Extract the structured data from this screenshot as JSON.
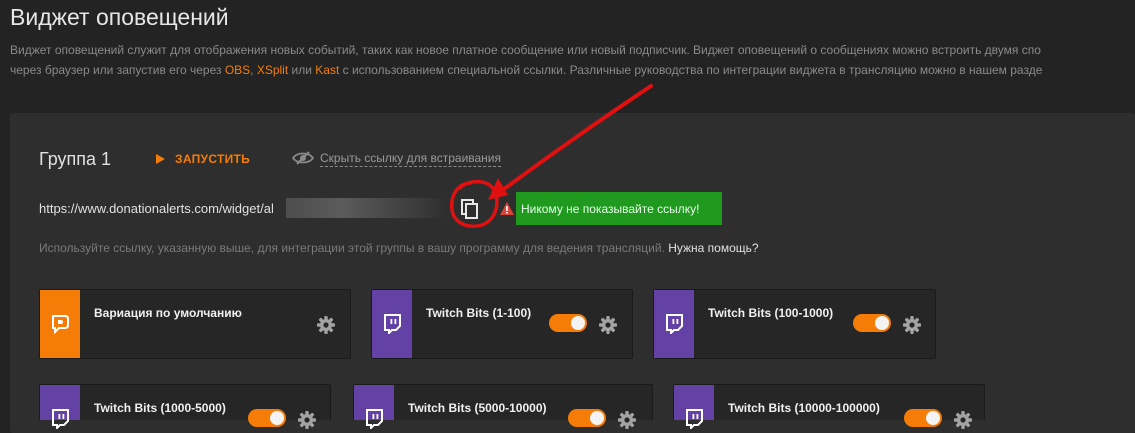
{
  "page": {
    "title": "Виджет оповещений",
    "desc_line1": "Виджет оповещений служит для отображения новых событий, таких как новое платное сообщение или новый подписчик. Виджет оповещений о сообщениях можно встроить двумя спо",
    "desc_line2_pre": "через браузер или запустив его через ",
    "link_obs": "OBS",
    "sep_comma": ", ",
    "link_xsplit": "XSplit",
    "sep_or": " или ",
    "link_kast": "Kast",
    "desc_line2_post": " с использованием специальной ссылки. Различные руководства по интеграции виджета в трансляцию можно в нашем разде"
  },
  "group": {
    "title": "Группа 1",
    "launch_label": "ЗАПУСТИТЬ",
    "hide_link_label": "Скрыть ссылку для встраивания",
    "url_visible": "https://www.donationalerts.com/widget/al",
    "warning": "Никому не показывайте ссылку!",
    "hint": "Используйте ссылку, указанную выше, для интеграции этой группы в вашу программу для ведения трансляций.",
    "help_link": "Нужна помощь?"
  },
  "cards": [
    {
      "name": "Вариация по умолчанию",
      "icon": "donationalerts-icon",
      "accent": "#f57d07",
      "toggle": false
    },
    {
      "name": "Twitch Bits (1-100)",
      "icon": "twitch-icon",
      "accent": "#6441a5",
      "toggle": true
    },
    {
      "name": "Twitch Bits (100-1000)",
      "icon": "twitch-icon",
      "accent": "#6441a5",
      "toggle": true
    },
    {
      "name": "Twitch Bits (1000-5000)",
      "icon": "twitch-icon",
      "accent": "#6441a5",
      "toggle": true
    },
    {
      "name": "Twitch Bits (5000-10000)",
      "icon": "twitch-icon",
      "accent": "#6441a5",
      "toggle": true
    },
    {
      "name": "Twitch Bits (10000-100000)",
      "icon": "twitch-icon",
      "accent": "#6441a5",
      "toggle": true
    }
  ],
  "colors": {
    "accent": "#f57d07",
    "twitch": "#6441a5",
    "warning_bg": "#1f9a1f",
    "annotation": "#e01010"
  }
}
